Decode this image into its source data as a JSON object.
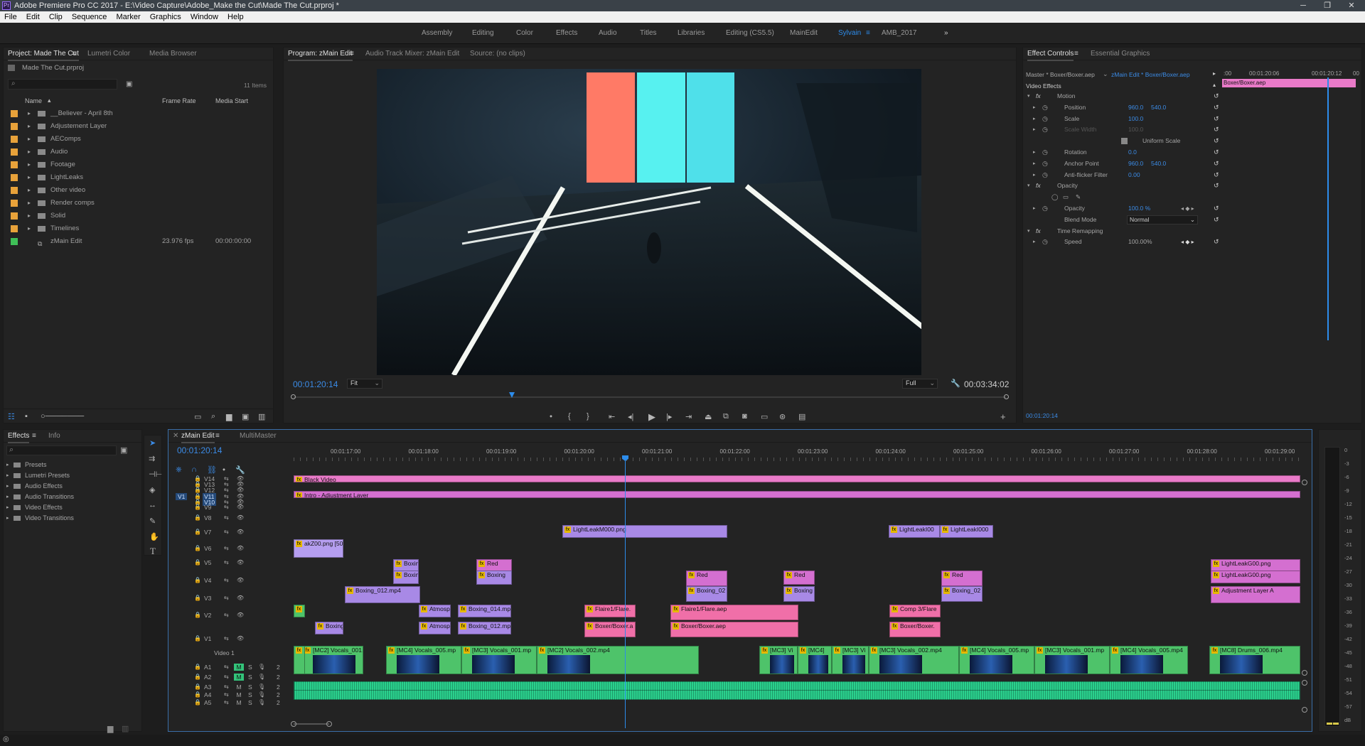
{
  "titlebar": {
    "title": "Adobe Premiere Pro CC 2017 - E:\\Video Capture\\Adobe_Make the Cut\\Made The Cut.prproj *",
    "app_icon": "Pr",
    "minimize": "─",
    "maximize": "❐",
    "close": "✕"
  },
  "menu": [
    "File",
    "Edit",
    "Clip",
    "Sequence",
    "Marker",
    "Graphics",
    "Window",
    "Help"
  ],
  "workspaces": [
    "Assembly",
    "Editing",
    "Color",
    "Effects",
    "Audio",
    "Titles",
    "Libraries",
    "Editing (CS5.5)",
    "MainEdit",
    "Sylvain",
    "AMB_2017"
  ],
  "workspace_active": "Sylvain",
  "project": {
    "tabs": [
      "Project: Made The Cut",
      "Lumetri Color",
      "Media Browser"
    ],
    "file": "Made The Cut.prproj",
    "items_count": "11 Items",
    "cols": [
      "Name",
      "Frame Rate",
      "Media Start"
    ],
    "rows": [
      {
        "name": "__Believer - April 8th",
        "color": "#e8a23a",
        "fps": "",
        "start": ""
      },
      {
        "name": "Adjustement Layer",
        "color": "#e8a23a",
        "fps": "",
        "start": ""
      },
      {
        "name": "AEComps",
        "color": "#e8a23a",
        "fps": "",
        "start": ""
      },
      {
        "name": "Audio",
        "color": "#e8a23a",
        "fps": "",
        "start": ""
      },
      {
        "name": "Footage",
        "color": "#e8a23a",
        "fps": "",
        "start": ""
      },
      {
        "name": "LightLeaks",
        "color": "#e8a23a",
        "fps": "",
        "start": ""
      },
      {
        "name": "Other video",
        "color": "#e8a23a",
        "fps": "",
        "start": ""
      },
      {
        "name": "Render comps",
        "color": "#e8a23a",
        "fps": "",
        "start": ""
      },
      {
        "name": "Solid",
        "color": "#e8a23a",
        "fps": "",
        "start": ""
      },
      {
        "name": "Timelines",
        "color": "#e8a23a",
        "fps": "",
        "start": ""
      },
      {
        "name": "zMain Edit",
        "color": "#3fbf57",
        "fps": "23.976 fps",
        "start": "00:00:00:00"
      }
    ]
  },
  "program": {
    "tabs": [
      "Program: zMain Edit",
      "Audio Track Mixer: zMain Edit",
      "Source: (no clips)"
    ],
    "timecode": "00:01:20:14",
    "fit": "Fit",
    "quality": "Full",
    "duration": "00:03:34:02"
  },
  "effect_controls": {
    "tabs": [
      "Effect Controls",
      "Essential Graphics"
    ],
    "master": "Master * Boxer/Boxer.aep",
    "clip": "zMain Edit * Boxer/Boxer.aep",
    "ruler": [
      ":00",
      "00:01:20:06",
      "00:01:20:12",
      "00"
    ],
    "clip_bar": "Boxer/Boxer.aep",
    "section": "Video Effects",
    "rows": [
      {
        "label": "Motion",
        "v1": "",
        "v2": "",
        "indent": 1
      },
      {
        "label": "Position",
        "v1": "960.0",
        "v2": "540.0",
        "indent": 2
      },
      {
        "label": "Scale",
        "v1": "100.0",
        "v2": "",
        "indent": 2
      },
      {
        "label": "Scale Width",
        "v1": "100.0",
        "v2": "",
        "indent": 2
      },
      {
        "label": "Uniform Scale",
        "v1": "",
        "v2": "",
        "indent": 3
      },
      {
        "label": "Rotation",
        "v1": "0.0",
        "v2": "",
        "indent": 2
      },
      {
        "label": "Anchor Point",
        "v1": "960.0",
        "v2": "540.0",
        "indent": 2
      },
      {
        "label": "Anti-flicker Filter",
        "v1": "0.00",
        "v2": "",
        "indent": 2
      },
      {
        "label": "Opacity",
        "v1": "",
        "v2": "",
        "indent": 1
      },
      {
        "label": "",
        "v1": "",
        "v2": "",
        "indent": 2
      },
      {
        "label": "Opacity",
        "v1": "100.0 %",
        "v2": "",
        "indent": 2
      },
      {
        "label": "Blend Mode",
        "v1": "Normal",
        "v2": "",
        "indent": 2
      },
      {
        "label": "Time Remapping",
        "v1": "",
        "v2": "",
        "indent": 1
      },
      {
        "label": "Speed",
        "v1": "100.00%",
        "v2": "",
        "indent": 2
      }
    ],
    "timecode": "00:01:20:14"
  },
  "effects": {
    "tabs": [
      "Effects",
      "Info"
    ],
    "folders": [
      "Presets",
      "Lumetri Presets",
      "Audio Effects",
      "Audio Transitions",
      "Video Effects",
      "Video Transitions"
    ]
  },
  "timeline": {
    "tabs": [
      "zMain Edit",
      "MultiMaster"
    ],
    "timecode": "00:01:20:14",
    "ruler": [
      "00:01:17:00",
      "00:01:18:00",
      "00:01:19:00",
      "00:01:20:00",
      "00:01:21:00",
      "00:01:22:00",
      "00:01:23:00",
      "00:01:24:00",
      "00:01:25:00",
      "00:01:26:00",
      "00:01:27:00",
      "00:01:28:00",
      "00:01:29:00"
    ],
    "v1_label": "Video 1",
    "tracks_v": [
      "V14",
      "V13",
      "V12",
      "V11",
      "V10",
      "V9",
      "V8",
      "V7",
      "V6",
      "V5",
      "V4",
      "V3",
      "V2",
      "V1"
    ],
    "tracks_a": [
      "A1",
      "A2",
      "A3",
      "A4",
      "A5"
    ],
    "source_patch": "V1",
    "clips": [
      {
        "label": "Black Video",
        "cls": "pink"
      },
      {
        "label": "Intro - Adjustment Layer",
        "cls": "mag"
      },
      {
        "label": "LightLeakM000.png",
        "cls": "violet"
      },
      {
        "label": "LightLeakI00",
        "cls": "violet"
      },
      {
        "label": "LightLeakI000",
        "cls": "violet"
      },
      {
        "label": "akZ00.png [50%]",
        "cls": "lav"
      },
      {
        "label": "Boxin",
        "cls": "violet"
      },
      {
        "label": "Red",
        "cls": "mag"
      },
      {
        "label": "Boxin",
        "cls": "violet"
      },
      {
        "label": "Boxing",
        "cls": "violet"
      },
      {
        "label": "Red",
        "cls": "mag"
      },
      {
        "label": "Red",
        "cls": "mag"
      },
      {
        "label": "Red",
        "cls": "mag"
      },
      {
        "label": "Boxing_012.mp4",
        "cls": "violet"
      },
      {
        "label": "Boxing_02",
        "cls": "violet"
      },
      {
        "label": "Boxing",
        "cls": "violet"
      },
      {
        "label": "Boxing_02",
        "cls": "violet"
      },
      {
        "label": "LightLeakG00.png",
        "cls": "mag"
      },
      {
        "label": "LightLeakG00.png",
        "cls": "mag"
      },
      {
        "label": "Adjustment Layer A",
        "cls": "mag"
      },
      {
        "label": "Atmosp",
        "cls": "violet"
      },
      {
        "label": "Boxing_014.mp",
        "cls": "violet"
      },
      {
        "label": "Flaire1/Flare.",
        "cls": "rose"
      },
      {
        "label": "Flaire1/Flare.aep",
        "cls": "rose"
      },
      {
        "label": "Comp 3/Flare",
        "cls": "rose"
      },
      {
        "label": "Boxing_",
        "cls": "violet"
      },
      {
        "label": "Atmosp",
        "cls": "violet"
      },
      {
        "label": "Boxing_012.mp",
        "cls": "violet"
      },
      {
        "label": "Boxer/Boxer.a",
        "cls": "rose"
      },
      {
        "label": "Boxer/Boxer.aep",
        "cls": "rose"
      },
      {
        "label": "Boxer/Boxer.",
        "cls": "rose"
      },
      {
        "label": "[MC2] Vocals_001.mp4",
        "cls": "green"
      },
      {
        "label": "[MC4] Vocals_005.mp",
        "cls": "green"
      },
      {
        "label": "[MC3] Vocals_001.mp",
        "cls": "green"
      },
      {
        "label": "[MC2] Vocals_002.mp4",
        "cls": "green"
      },
      {
        "label": "[MC3] Vi",
        "cls": "green"
      },
      {
        "label": "[MC4] ",
        "cls": "green"
      },
      {
        "label": "[MC3] Vi",
        "cls": "green"
      },
      {
        "label": "[MC3] Vocals_002.mp4",
        "cls": "green"
      },
      {
        "label": "[MC4] Vocals_005.mp",
        "cls": "green"
      },
      {
        "label": "[MC3] Vocals_001.mp",
        "cls": "green"
      },
      {
        "label": "[MC4] Vocals_005.mp4",
        "cls": "green"
      },
      {
        "label": "[MC8] Drums_006.mp4",
        "cls": "green"
      },
      {
        "label": "06",
        "cls": "green"
      },
      {
        "label": "p4",
        "cls": "green"
      }
    ],
    "meter_ticks": [
      "0",
      "-3",
      "-6",
      "-9",
      "-12",
      "-15",
      "-18",
      "-21",
      "-24",
      "-27",
      "-30",
      "-33",
      "-36",
      "-39",
      "-42",
      "-45",
      "-48",
      "-51",
      "-54",
      "-57",
      "dB"
    ]
  }
}
